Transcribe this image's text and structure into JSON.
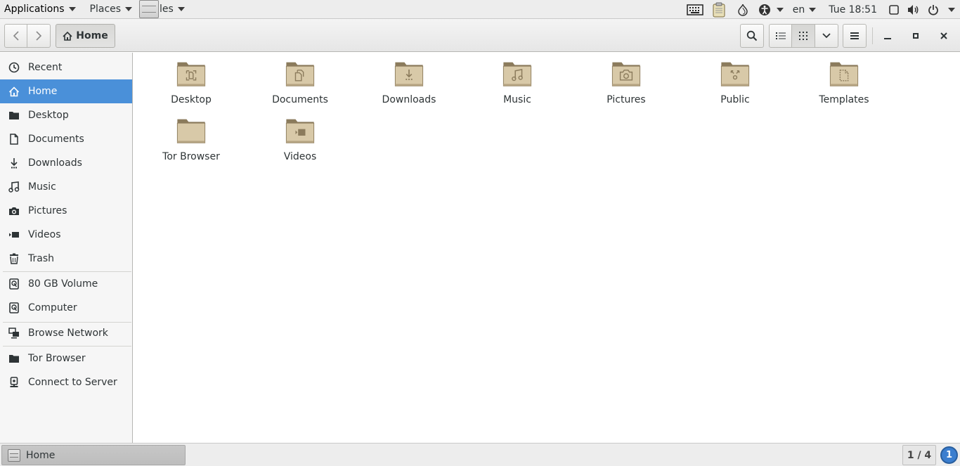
{
  "top_panel": {
    "applications_label": "Applications",
    "places_label": "Places",
    "files_label": "Files",
    "language": "en",
    "clock": "Tue 18:51"
  },
  "header": {
    "breadcrumb_label": "Home"
  },
  "sidebar": {
    "items": [
      {
        "label": "Recent",
        "icon": "clock-icon"
      },
      {
        "label": "Home",
        "icon": "home-icon",
        "active": true
      },
      {
        "label": "Desktop",
        "icon": "folder-icon"
      },
      {
        "label": "Documents",
        "icon": "document-icon"
      },
      {
        "label": "Downloads",
        "icon": "download-icon"
      },
      {
        "label": "Music",
        "icon": "music-icon"
      },
      {
        "label": "Pictures",
        "icon": "camera-icon"
      },
      {
        "label": "Videos",
        "icon": "video-icon"
      },
      {
        "label": "Trash",
        "icon": "trash-icon"
      },
      {
        "label": "80 GB Volume",
        "icon": "drive-icon"
      },
      {
        "label": "Computer",
        "icon": "drive-icon"
      },
      {
        "label": "Browse Network",
        "icon": "network-icon"
      },
      {
        "label": "Tor Browser",
        "icon": "folder-icon"
      },
      {
        "label": "Connect to Server",
        "icon": "server-icon"
      }
    ]
  },
  "files": [
    {
      "label": "Desktop",
      "emblem": "desktop"
    },
    {
      "label": "Documents",
      "emblem": "documents"
    },
    {
      "label": "Downloads",
      "emblem": "downloads"
    },
    {
      "label": "Music",
      "emblem": "music"
    },
    {
      "label": "Pictures",
      "emblem": "pictures"
    },
    {
      "label": "Public",
      "emblem": "public"
    },
    {
      "label": "Templates",
      "emblem": "templates"
    },
    {
      "label": "Tor Browser",
      "emblem": "none"
    },
    {
      "label": "Videos",
      "emblem": "videos"
    }
  ],
  "bottom_panel": {
    "task_label": "Home",
    "workspace": "1 / 4",
    "notification_count": "1"
  },
  "colors": {
    "accent": "#4a90d9",
    "folder": "#d8c9a8",
    "folder_dark": "#8b7b5c"
  }
}
